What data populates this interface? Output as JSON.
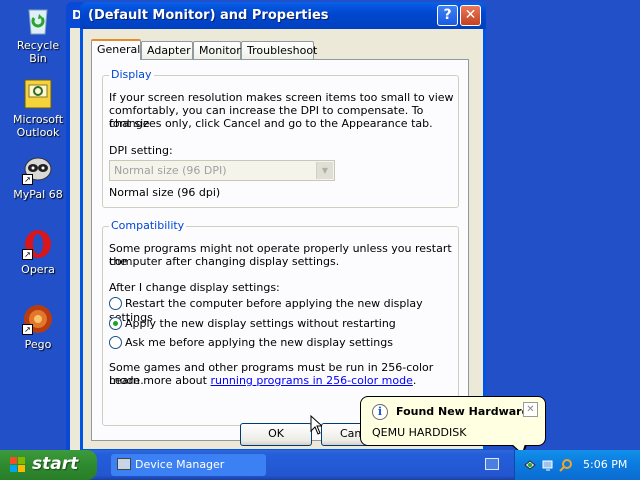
{
  "desktop": {
    "icons": [
      {
        "label": "Recycle Bin",
        "icon": "recycle-bin-icon"
      },
      {
        "label": "Microsoft Outlook",
        "icon": "outlook-icon"
      },
      {
        "label": "MyPal 68",
        "icon": "mypal-icon"
      },
      {
        "label": "Opera",
        "icon": "opera-icon"
      },
      {
        "label": "Pego",
        "icon": "pego-icon"
      }
    ]
  },
  "bg_window": {
    "title_fragment": "D"
  },
  "dialog": {
    "title": "(Default Monitor) and  Properties",
    "help_label": "?",
    "close_label": "✕",
    "tabs": [
      "General",
      "Adapter",
      "Monitor",
      "Troubleshoot"
    ],
    "active_tab": "General",
    "display": {
      "legend": "Display",
      "text_lines": [
        "If your screen resolution makes screen items too small to view",
        "comfortably, you can increase the DPI to compensate.  To change",
        "font sizes only, click Cancel and go to the Appearance tab."
      ],
      "dpi_label": "DPI setting:",
      "dpi_value": "Normal size (96 DPI)",
      "dpi_note": "Normal size (96 dpi)"
    },
    "compatibility": {
      "legend": "Compatibility",
      "text_lines": [
        "Some programs might not operate properly unless you restart the",
        "computer after changing display settings."
      ],
      "after_label": "After I change display settings:",
      "options": [
        {
          "label": "Restart the computer before applying the new display settings",
          "checked": false
        },
        {
          "label": "Apply the new display settings without restarting",
          "checked": true
        },
        {
          "label": "Ask me before applying the new display settings",
          "checked": false
        }
      ],
      "footer_line1": "Some games and other programs must be run in 256-color mode.",
      "footer_prefix": "Learn more about ",
      "footer_link": "running programs in 256-color mode",
      "footer_suffix": "."
    },
    "buttons": {
      "ok": "OK",
      "cancel": "Canc"
    }
  },
  "balloon": {
    "title": "Found New Hardware",
    "message": "QEMU HARDDISK",
    "close_label": "✕"
  },
  "taskbar": {
    "start_label": "start",
    "tasks": [
      {
        "label": "Device Manager"
      }
    ],
    "clock": "5:06 PM"
  },
  "colors": {
    "desktop": "#2150c8",
    "titlebar": "#0055e5",
    "start_green": "#2f8a2f",
    "tray": "#0c7ae0",
    "legend_blue": "#0046d5"
  }
}
